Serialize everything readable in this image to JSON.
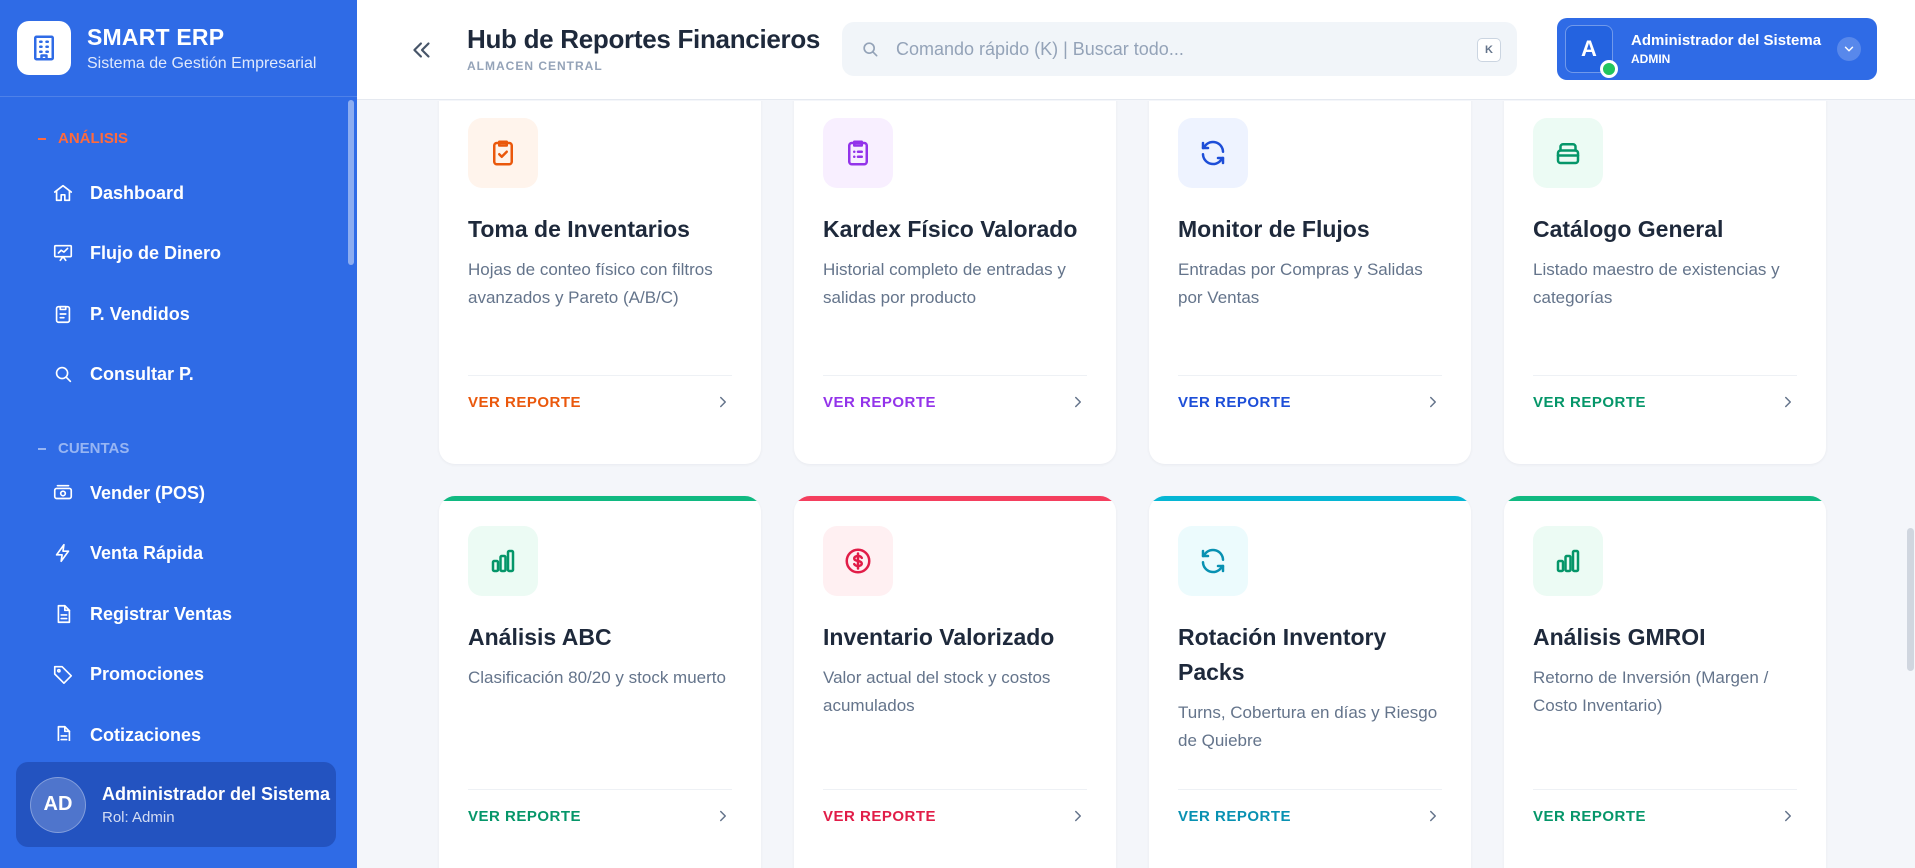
{
  "sidebar": {
    "brand_name": "SMART ERP",
    "brand_sub": "Sistema de Gestión Empresarial",
    "sections": [
      {
        "title": "ANÁLISIS",
        "items": [
          "Dashboard",
          "Flujo de Dinero",
          "P. Vendidos",
          "Consultar P."
        ]
      },
      {
        "title": "CUENTAS",
        "items": [
          "Vender (POS)",
          "Venta Rápida",
          "Registrar Ventas",
          "Promociones",
          "Cotizaciones"
        ]
      }
    ],
    "user": {
      "initials": "AD",
      "name": "Administrador del Sistema",
      "role": "Rol: Admin"
    }
  },
  "header": {
    "title": "Hub de Reportes Financieros",
    "subtitle": "ALMACEN CENTRAL",
    "search_placeholder": "Comando rápido (K) | Buscar todo...",
    "search_shortcut": "K",
    "profile": {
      "initial": "A",
      "name": "Administrador del Sistema",
      "role": "ADMIN"
    }
  },
  "cards": [
    {
      "title": "Toma de Inventarios",
      "desc": "Hojas de conteo físico con filtros avanzados y Pareto (A/B/C)",
      "link": "VER REPORTE",
      "icon": "clipboard-check-icon",
      "color": "#ea580c",
      "bg": "#fff4ec"
    },
    {
      "title": "Kardex Físico Valorado",
      "desc": "Historial completo de entradas y salidas por producto",
      "link": "VER REPORTE",
      "icon": "clipboard-list-icon",
      "color": "#9333ea",
      "bg": "#f8efff"
    },
    {
      "title": "Monitor de Flujos",
      "desc": "Entradas por Compras y Salidas por Ventas",
      "link": "VER REPORTE",
      "icon": "refresh-icon",
      "color": "#1d4ed8",
      "bg": "#eef3ff"
    },
    {
      "title": "Catálogo General",
      "desc": "Listado maestro de existencias y categorías",
      "link": "VER REPORTE",
      "icon": "archive-icon",
      "color": "#059669",
      "bg": "#ecfbf4"
    },
    {
      "title": "Análisis ABC",
      "desc": "Clasificación 80/20 y stock muerto",
      "link": "VER REPORTE",
      "icon": "bar-chart-icon",
      "color": "#059669",
      "bg": "#ecfbf4",
      "accent": "#10b981"
    },
    {
      "title": "Inventario Valorizado",
      "desc": "Valor actual del stock y costos acumulados",
      "link": "VER REPORTE",
      "icon": "dollar-circle-icon",
      "color": "#e11d48",
      "bg": "#fff0f2",
      "accent": "#f43f5e"
    },
    {
      "title": "Rotación Inventory Packs",
      "desc": "Turns, Cobertura en días y Riesgo de Quiebre",
      "link": "VER REPORTE",
      "icon": "refresh-icon",
      "color": "#0891b2",
      "bg": "#ecfbfd",
      "accent": "#06b6d4"
    },
    {
      "title": "Análisis GMROI",
      "desc": "Retorno de Inversión (Margen / Costo Inventario)",
      "link": "VER REPORTE",
      "icon": "bar-chart-icon",
      "color": "#059669",
      "bg": "#ecfbf4",
      "accent": "#10b981"
    }
  ]
}
